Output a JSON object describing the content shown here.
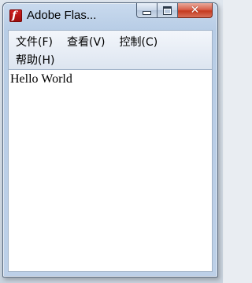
{
  "window": {
    "title": "Adobe Flas...",
    "app_icon": "flash-player-icon",
    "app_icon_glyph": "f",
    "controls": {
      "minimize_icon": "minimize-icon",
      "maximize_icon": "maximize-icon",
      "close_icon": "close-icon",
      "close_glyph": "✕"
    }
  },
  "menubar": {
    "items": [
      {
        "label": "文件(F)"
      },
      {
        "label": "查看(V)"
      },
      {
        "label": "控制(C)"
      },
      {
        "label": "帮助(H)"
      }
    ]
  },
  "content": {
    "text": "Hello World"
  },
  "colors": {
    "close_button": "#c53a1f",
    "title_bar": "#c9daee",
    "content_bg": "#ffffff"
  }
}
